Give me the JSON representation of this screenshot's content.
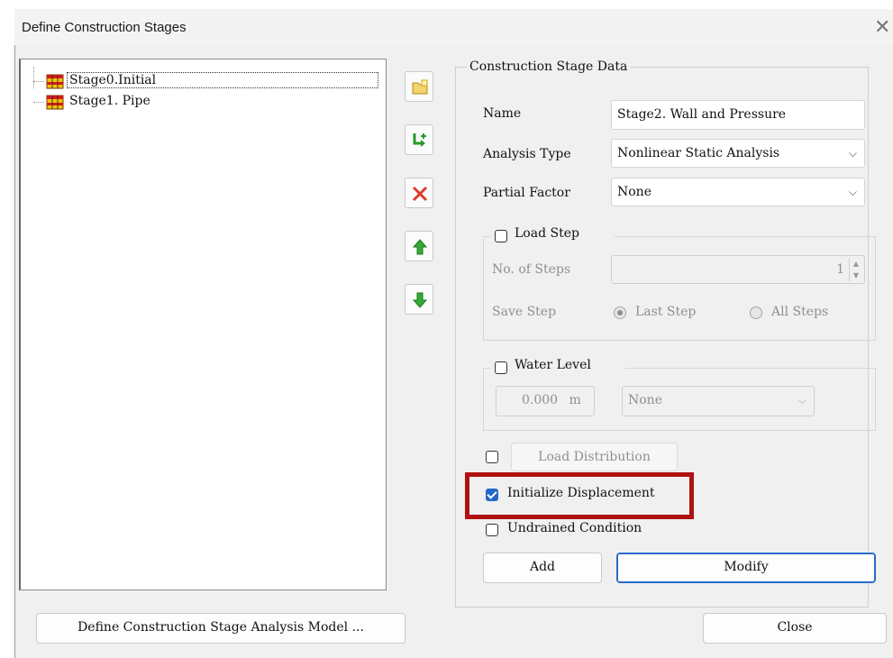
{
  "window": {
    "title": "Define Construction Stages",
    "close_glyph": "✕"
  },
  "tree": {
    "items": [
      {
        "label": "Stage0.Initial",
        "icon": "stage-icon"
      },
      {
        "label": "Stage1. Pipe",
        "icon": "stage-icon"
      }
    ]
  },
  "toolbar": {
    "icons": [
      "new-folder-icon",
      "insert-stage-icon",
      "delete-icon",
      "move-up-icon",
      "move-down-icon"
    ]
  },
  "stage_data": {
    "legend": "Construction Stage Data",
    "name_label": "Name",
    "name_value": "Stage2. Wall and Pressure",
    "analysis_type_label": "Analysis Type",
    "analysis_type_value": "Nonlinear Static Analysis",
    "partial_factor_label": "Partial Factor",
    "partial_factor_value": "None",
    "load_step": {
      "label": "Load Step",
      "checked": false,
      "steps_label": "No. of Steps",
      "steps_value": "1",
      "save_step_label": "Save Step",
      "last_step_label": "Last Step",
      "all_steps_label": "All Steps"
    },
    "water_level": {
      "label": "Water Level",
      "checked": false,
      "value": "0.000",
      "unit": "m",
      "function_value": "None"
    },
    "load_distribution_label": "Load Distribution",
    "initialize_displacement_label": "Initialize Displacement",
    "initialize_displacement_checked": true,
    "undrained_condition_label": "Undrained Condition",
    "add_label": "Add",
    "modify_label": "Modify"
  },
  "footer": {
    "define_model_label": "Define Construction Stage Analysis Model ...",
    "close_label": "Close"
  },
  "colors": {
    "highlight": "#b01212",
    "check_accent": "#2567c7",
    "primary_border": "#2a6bcc"
  }
}
